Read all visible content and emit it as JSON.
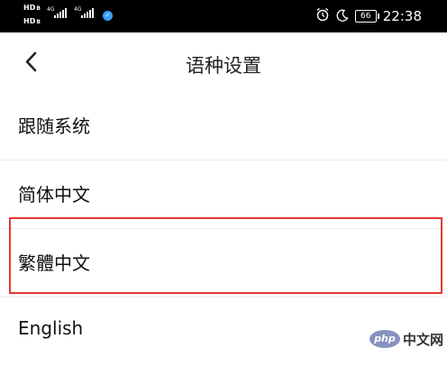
{
  "status_bar": {
    "hd_label": "HD",
    "slot_label": "B",
    "network_1": "4G",
    "network_2": "4G",
    "battery_level": "66",
    "time": "22:38",
    "icons": [
      "alarm-icon",
      "moon-icon",
      "battery-icon",
      "wifi-calling-icon"
    ]
  },
  "header": {
    "back_icon": "chevron-left-icon",
    "title": "语种设置"
  },
  "languages": [
    {
      "label": "跟随系统"
    },
    {
      "label": "简体中文"
    },
    {
      "label": "繁體中文",
      "highlighted": true
    },
    {
      "label": "English"
    }
  ],
  "watermark": {
    "logo_text": "php",
    "site_text": "中文网"
  },
  "colors": {
    "status_bar_bg": "#000000",
    "highlight_border": "#e53935",
    "divider": "#ececec"
  }
}
